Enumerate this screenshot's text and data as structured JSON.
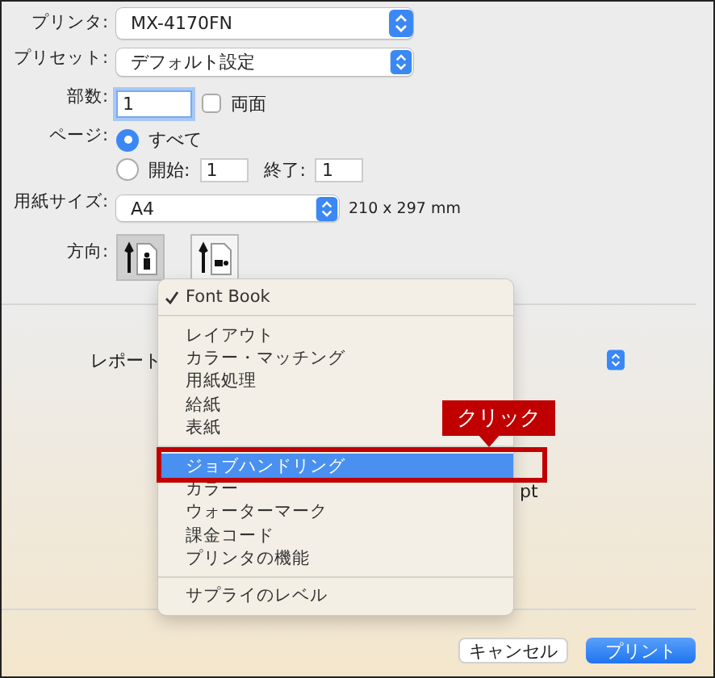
{
  "printer": {
    "label": "プリンタ:",
    "value": "MX-4170FN"
  },
  "preset": {
    "label": "プリセット:",
    "value": "デフォルト設定"
  },
  "copies": {
    "label": "部数:",
    "value": "1",
    "duplex": {
      "label": "両面",
      "checked": false
    }
  },
  "pages": {
    "label": "ページ:",
    "options": [
      {
        "label": "すべて",
        "selected": true
      },
      {
        "label": "開始:",
        "selected": false,
        "from": "1",
        "to_label": "終了:",
        "to": "1"
      }
    ]
  },
  "paper_size": {
    "label": "用紙サイズ:",
    "value": "A4",
    "dimensions": "210 x 297 mm"
  },
  "orientation": {
    "label": "方向:",
    "options": [
      {
        "kind": "portrait",
        "selected": true
      },
      {
        "kind": "landscape",
        "selected": false
      }
    ]
  },
  "covered_label": "レポート",
  "covered_unit": "pt",
  "menu": {
    "groups": [
      [
        {
          "label": "Font Book",
          "checked": true,
          "selected": false
        }
      ],
      [
        {
          "label": "レイアウト",
          "checked": false,
          "selected": false
        },
        {
          "label": "カラー・マッチング",
          "checked": false,
          "selected": false
        },
        {
          "label": "用紙処理",
          "checked": false,
          "selected": false
        },
        {
          "label": "給紙",
          "checked": false,
          "selected": false
        },
        {
          "label": "表紙",
          "checked": false,
          "selected": false
        }
      ],
      [
        {
          "label": "ジョブハンドリング",
          "checked": false,
          "selected": true
        },
        {
          "label": "カラー",
          "checked": false,
          "selected": false
        },
        {
          "label": "ウォーターマーク",
          "checked": false,
          "selected": false
        },
        {
          "label": "課金コード",
          "checked": false,
          "selected": false
        },
        {
          "label": "プリンタの機能",
          "checked": false,
          "selected": false
        }
      ],
      [
        {
          "label": "サプライのレベル",
          "checked": false,
          "selected": false
        }
      ]
    ]
  },
  "annotation": {
    "label": "クリック"
  },
  "buttons": [
    {
      "label": "キャンセル",
      "kind": "secondary"
    },
    {
      "label": "プリント",
      "kind": "primary"
    }
  ]
}
